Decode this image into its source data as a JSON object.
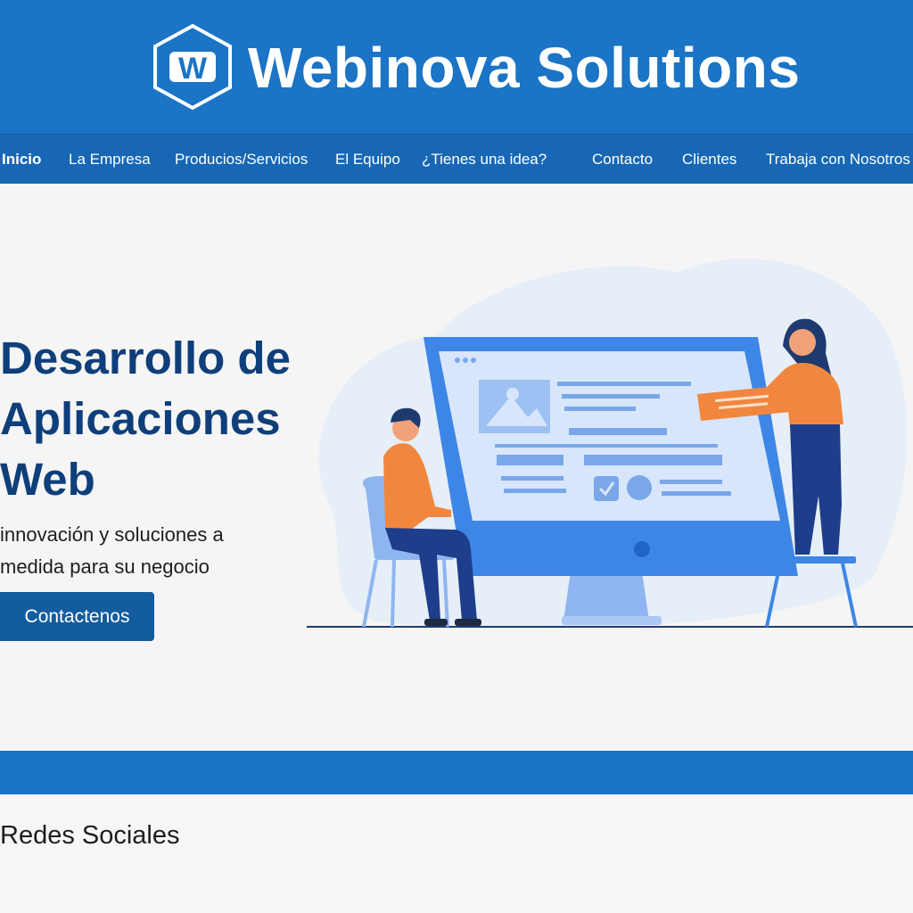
{
  "header": {
    "brand": "Webinova Solutions",
    "logo_letter": "W",
    "logo_icon": "hexagon-w-logo",
    "color": "#1b74c5"
  },
  "nav": {
    "items": [
      {
        "label": "Inicio",
        "active": true
      },
      {
        "label": "La Empresa"
      },
      {
        "label": "Producios/Servicios"
      },
      {
        "label": "El Equipo"
      },
      {
        "label": "¿Tienes una idea?"
      },
      {
        "label": "Contacto"
      },
      {
        "label": "Clientes"
      },
      {
        "label": "Trabaja con Nosotros"
      }
    ],
    "color": "#1767b4"
  },
  "hero": {
    "title_lines": [
      "Desarrollo de",
      "Aplicaciones",
      "Web"
    ],
    "subtitle_lines": [
      "innovación y soluciones a",
      "medida para su negocio"
    ],
    "cta_label": "Contactenos",
    "title_color": "#0f3f7a",
    "illustration": "web-development-team-illustration"
  },
  "social": {
    "title": "Redes Sociales"
  }
}
